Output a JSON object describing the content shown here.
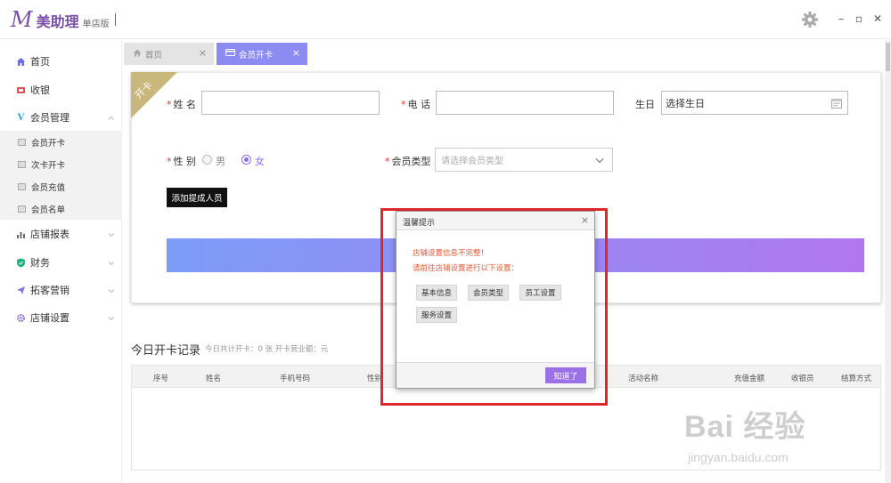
{
  "app": {
    "logo_letter": "M",
    "name": "美助理",
    "edition": "单店版"
  },
  "window_controls": {
    "minimize": "–",
    "maximize": "▫",
    "close": "✕"
  },
  "sidebar": {
    "items": [
      {
        "label": "首页",
        "icon": "home-icon"
      },
      {
        "label": "收银",
        "icon": "cashier-icon"
      },
      {
        "label": "会员管理",
        "icon": "v-icon"
      },
      {
        "label": "店铺报表",
        "icon": "chart-icon"
      },
      {
        "label": "财务",
        "icon": "shield-icon"
      },
      {
        "label": "拓客营销",
        "icon": "send-icon"
      },
      {
        "label": "店铺设置",
        "icon": "gear-icon"
      }
    ],
    "submenu": [
      {
        "label": "会员开卡"
      },
      {
        "label": "次卡开卡"
      },
      {
        "label": "会员充值"
      },
      {
        "label": "会员名单"
      }
    ]
  },
  "tabs": [
    {
      "label": "首页",
      "close": "×"
    },
    {
      "label": "会员开卡",
      "close": "×"
    }
  ],
  "form": {
    "ribbon": "开卡",
    "required_mark": "*",
    "name_label": "姓 名",
    "phone_label": "电 话",
    "birthday_label": "生日",
    "birthday_value": "选择生日",
    "gender_label": "性 别",
    "gender_male": "男",
    "gender_female": "女",
    "gender_selected": "女",
    "member_type_label": "会员类型",
    "member_type_placeholder": "请选择会员类型",
    "add_commission_button": "添加提成人员"
  },
  "records": {
    "title": "今日开卡记录",
    "meta": "今日共计开卡：0 张  开卡营业额：元",
    "columns": [
      "序号",
      "姓名",
      "手机号码",
      "性别",
      "活动名称",
      "充值金额",
      "收银员",
      "结算方式"
    ]
  },
  "dialog": {
    "title": "温馨提示",
    "close": "×",
    "message_1": "店铺设置信息不完整！",
    "message_2": "请前往店铺设置进行以下设置：",
    "chips": [
      "基本信息",
      "会员类型",
      "员工设置",
      "服务设置"
    ],
    "ok_button": "知道了"
  },
  "watermark": {
    "big": "Bai  经验",
    "small": "jingyan.baidu.com"
  },
  "colors": {
    "brand": "#7a4fa8",
    "tab_active": "#8b8bf2",
    "required": "#e03030",
    "dialog_message": "#e05a30",
    "highlight_border": "#e0282c",
    "ok_button": "#9b71e8"
  }
}
